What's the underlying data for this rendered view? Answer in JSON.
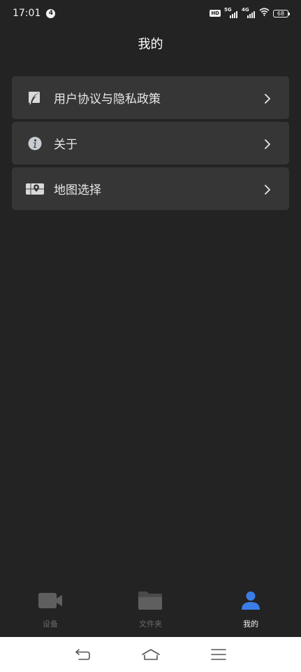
{
  "status_bar": {
    "time": "17:01",
    "notification_count": "4",
    "hd_label": "HD",
    "signal_1": "5G",
    "signal_2": "4G",
    "battery": "68"
  },
  "header": {
    "title": "我的"
  },
  "menu": {
    "items": [
      {
        "label": "用户协议与隐私政策",
        "icon": "feather-icon"
      },
      {
        "label": "关于",
        "icon": "info-icon"
      },
      {
        "label": "地图选择",
        "icon": "map-pin-icon"
      }
    ]
  },
  "tabs": [
    {
      "label": "设备",
      "icon": "camera-icon",
      "active": false
    },
    {
      "label": "文件夹",
      "icon": "folder-icon",
      "active": false
    },
    {
      "label": "我的",
      "icon": "person-icon",
      "active": true
    }
  ],
  "colors": {
    "background": "#232323",
    "card": "#363636",
    "accent": "#3b7de8",
    "inactive": "#6b6b6b"
  }
}
